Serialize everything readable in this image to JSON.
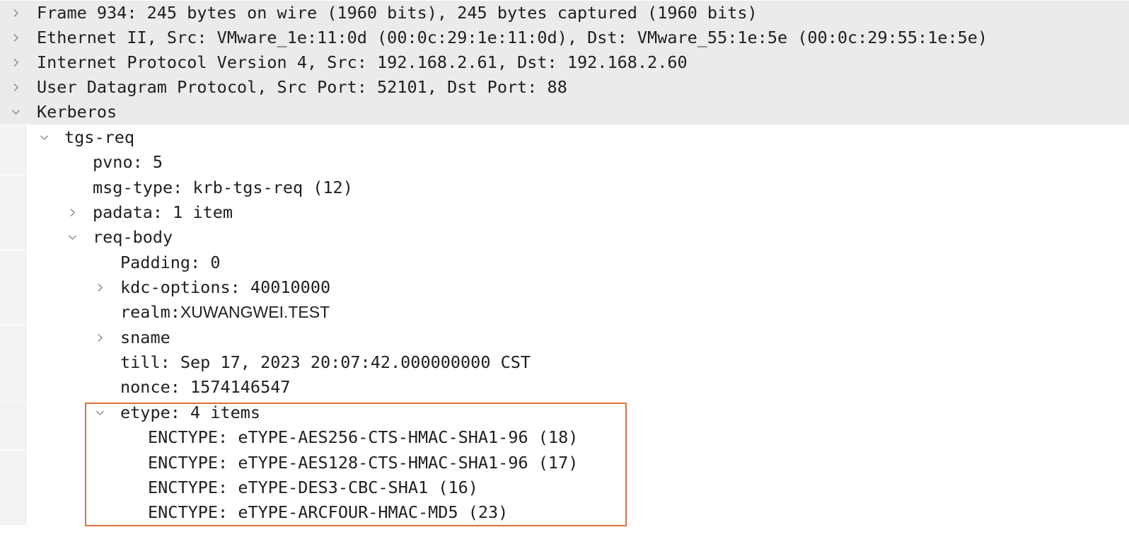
{
  "highlight_color": "#e0703b",
  "rows": [
    {
      "label": "Frame 934: 245 bytes on wire (1960 bits), 245 bytes captured (1960 bits)",
      "toggle": "collapsed",
      "icon": "chevron-right-icon"
    },
    {
      "label": "Ethernet II, Src: VMware_1e:11:0d (00:0c:29:1e:11:0d), Dst: VMware_55:1e:5e (00:0c:29:55:1e:5e)",
      "toggle": "collapsed",
      "icon": "chevron-right-icon"
    },
    {
      "label": "Internet Protocol Version 4, Src: 192.168.2.61, Dst: 192.168.2.60",
      "toggle": "collapsed",
      "icon": "chevron-right-icon"
    },
    {
      "label": "User Datagram Protocol, Src Port: 52101, Dst Port: 88",
      "toggle": "collapsed",
      "icon": "chevron-right-icon"
    },
    {
      "label": "Kerberos",
      "toggle": "expanded",
      "icon": "chevron-down-icon"
    },
    {
      "label": "tgs-req",
      "toggle": "expanded",
      "icon": "chevron-down-icon"
    },
    {
      "label": "pvno: 5"
    },
    {
      "label": "msg-type: krb-tgs-req (12)"
    },
    {
      "label": "padata: 1 item",
      "toggle": "collapsed",
      "icon": "chevron-right-icon"
    },
    {
      "label": "req-body",
      "toggle": "expanded",
      "icon": "chevron-down-icon"
    },
    {
      "label": "Padding: 0"
    },
    {
      "label": "kdc-options: 40010000",
      "toggle": "collapsed",
      "icon": "chevron-right-icon"
    },
    {
      "label": "realm:",
      "value": "XUWANGWEI.TEST"
    },
    {
      "label": "sname",
      "toggle": "collapsed",
      "icon": "chevron-right-icon"
    },
    {
      "label": "till: Sep 17, 2023 20:07:42.000000000 CST"
    },
    {
      "label": "nonce: 1574146547"
    },
    {
      "label": "etype: 4 items",
      "toggle": "expanded",
      "icon": "chevron-down-icon"
    },
    {
      "label": "ENCTYPE: eTYPE-AES256-CTS-HMAC-SHA1-96 (18)"
    },
    {
      "label": "ENCTYPE: eTYPE-AES128-CTS-HMAC-SHA1-96 (17)"
    },
    {
      "label": "ENCTYPE: eTYPE-DES3-CBC-SHA1 (16)"
    },
    {
      "label": "ENCTYPE: eTYPE-ARCFOUR-HMAC-MD5 (23)"
    }
  ]
}
